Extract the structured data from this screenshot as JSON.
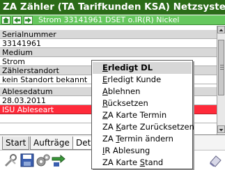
{
  "window": {
    "title": "ZA Zähler (TA Tarifkunden KSA) Netzsystem"
  },
  "nav": {
    "breadcrumb": "Strom 33141961 DSET o.IR(R) Nickel",
    "icons": [
      "home-icon",
      "back-arrow-icon",
      "forward-arrow-icon"
    ]
  },
  "fields": [
    {
      "label": "Serialnummer",
      "value": "33141961"
    },
    {
      "label": "Medium",
      "value": "Strom"
    },
    {
      "label": "Zählerstandort",
      "value": "kein Standort bekannt"
    },
    {
      "label": "Ablesedatum",
      "value": "28.03.2011"
    },
    {
      "label": "ISU Ableseart",
      "value": ""
    }
  ],
  "tabs": [
    "Start",
    "Aufträge",
    "Det"
  ],
  "context_menu": {
    "items": [
      {
        "pre": "",
        "key": "E",
        "post": "rledigt DL",
        "selected": true
      },
      {
        "pre": "",
        "key": "E",
        "post": "rledigt Kunde",
        "selected": false
      },
      {
        "pre": "",
        "key": "A",
        "post": "blehnen",
        "selected": false
      },
      {
        "pre": "",
        "key": "R",
        "post": "ücksetzen",
        "selected": false
      },
      {
        "pre": "",
        "key": "Z",
        "post": "A Karte Termin",
        "selected": false
      },
      {
        "pre": "ZA ",
        "key": "K",
        "post": "arte Zurücksetzen",
        "selected": false
      },
      {
        "pre": "ZA ",
        "key": "T",
        "post": "ermin ändern",
        "selected": false
      },
      {
        "pre": "",
        "key": "I",
        "post": "R Ablesung",
        "selected": false
      },
      {
        "pre": "ZA Karte ",
        "key": "S",
        "post": "tand",
        "selected": false
      }
    ]
  },
  "toolbar": {
    "icons": [
      "tools-icon",
      "save-icon",
      "settings-gears-icon",
      "transfer-icon",
      "eraser-icon"
    ]
  },
  "colors": {
    "title_bg": "#2b6b18",
    "nav_bg": "#66c85e",
    "highlight_row": "#ff2a3a",
    "label_row": "#d8d8d8"
  }
}
